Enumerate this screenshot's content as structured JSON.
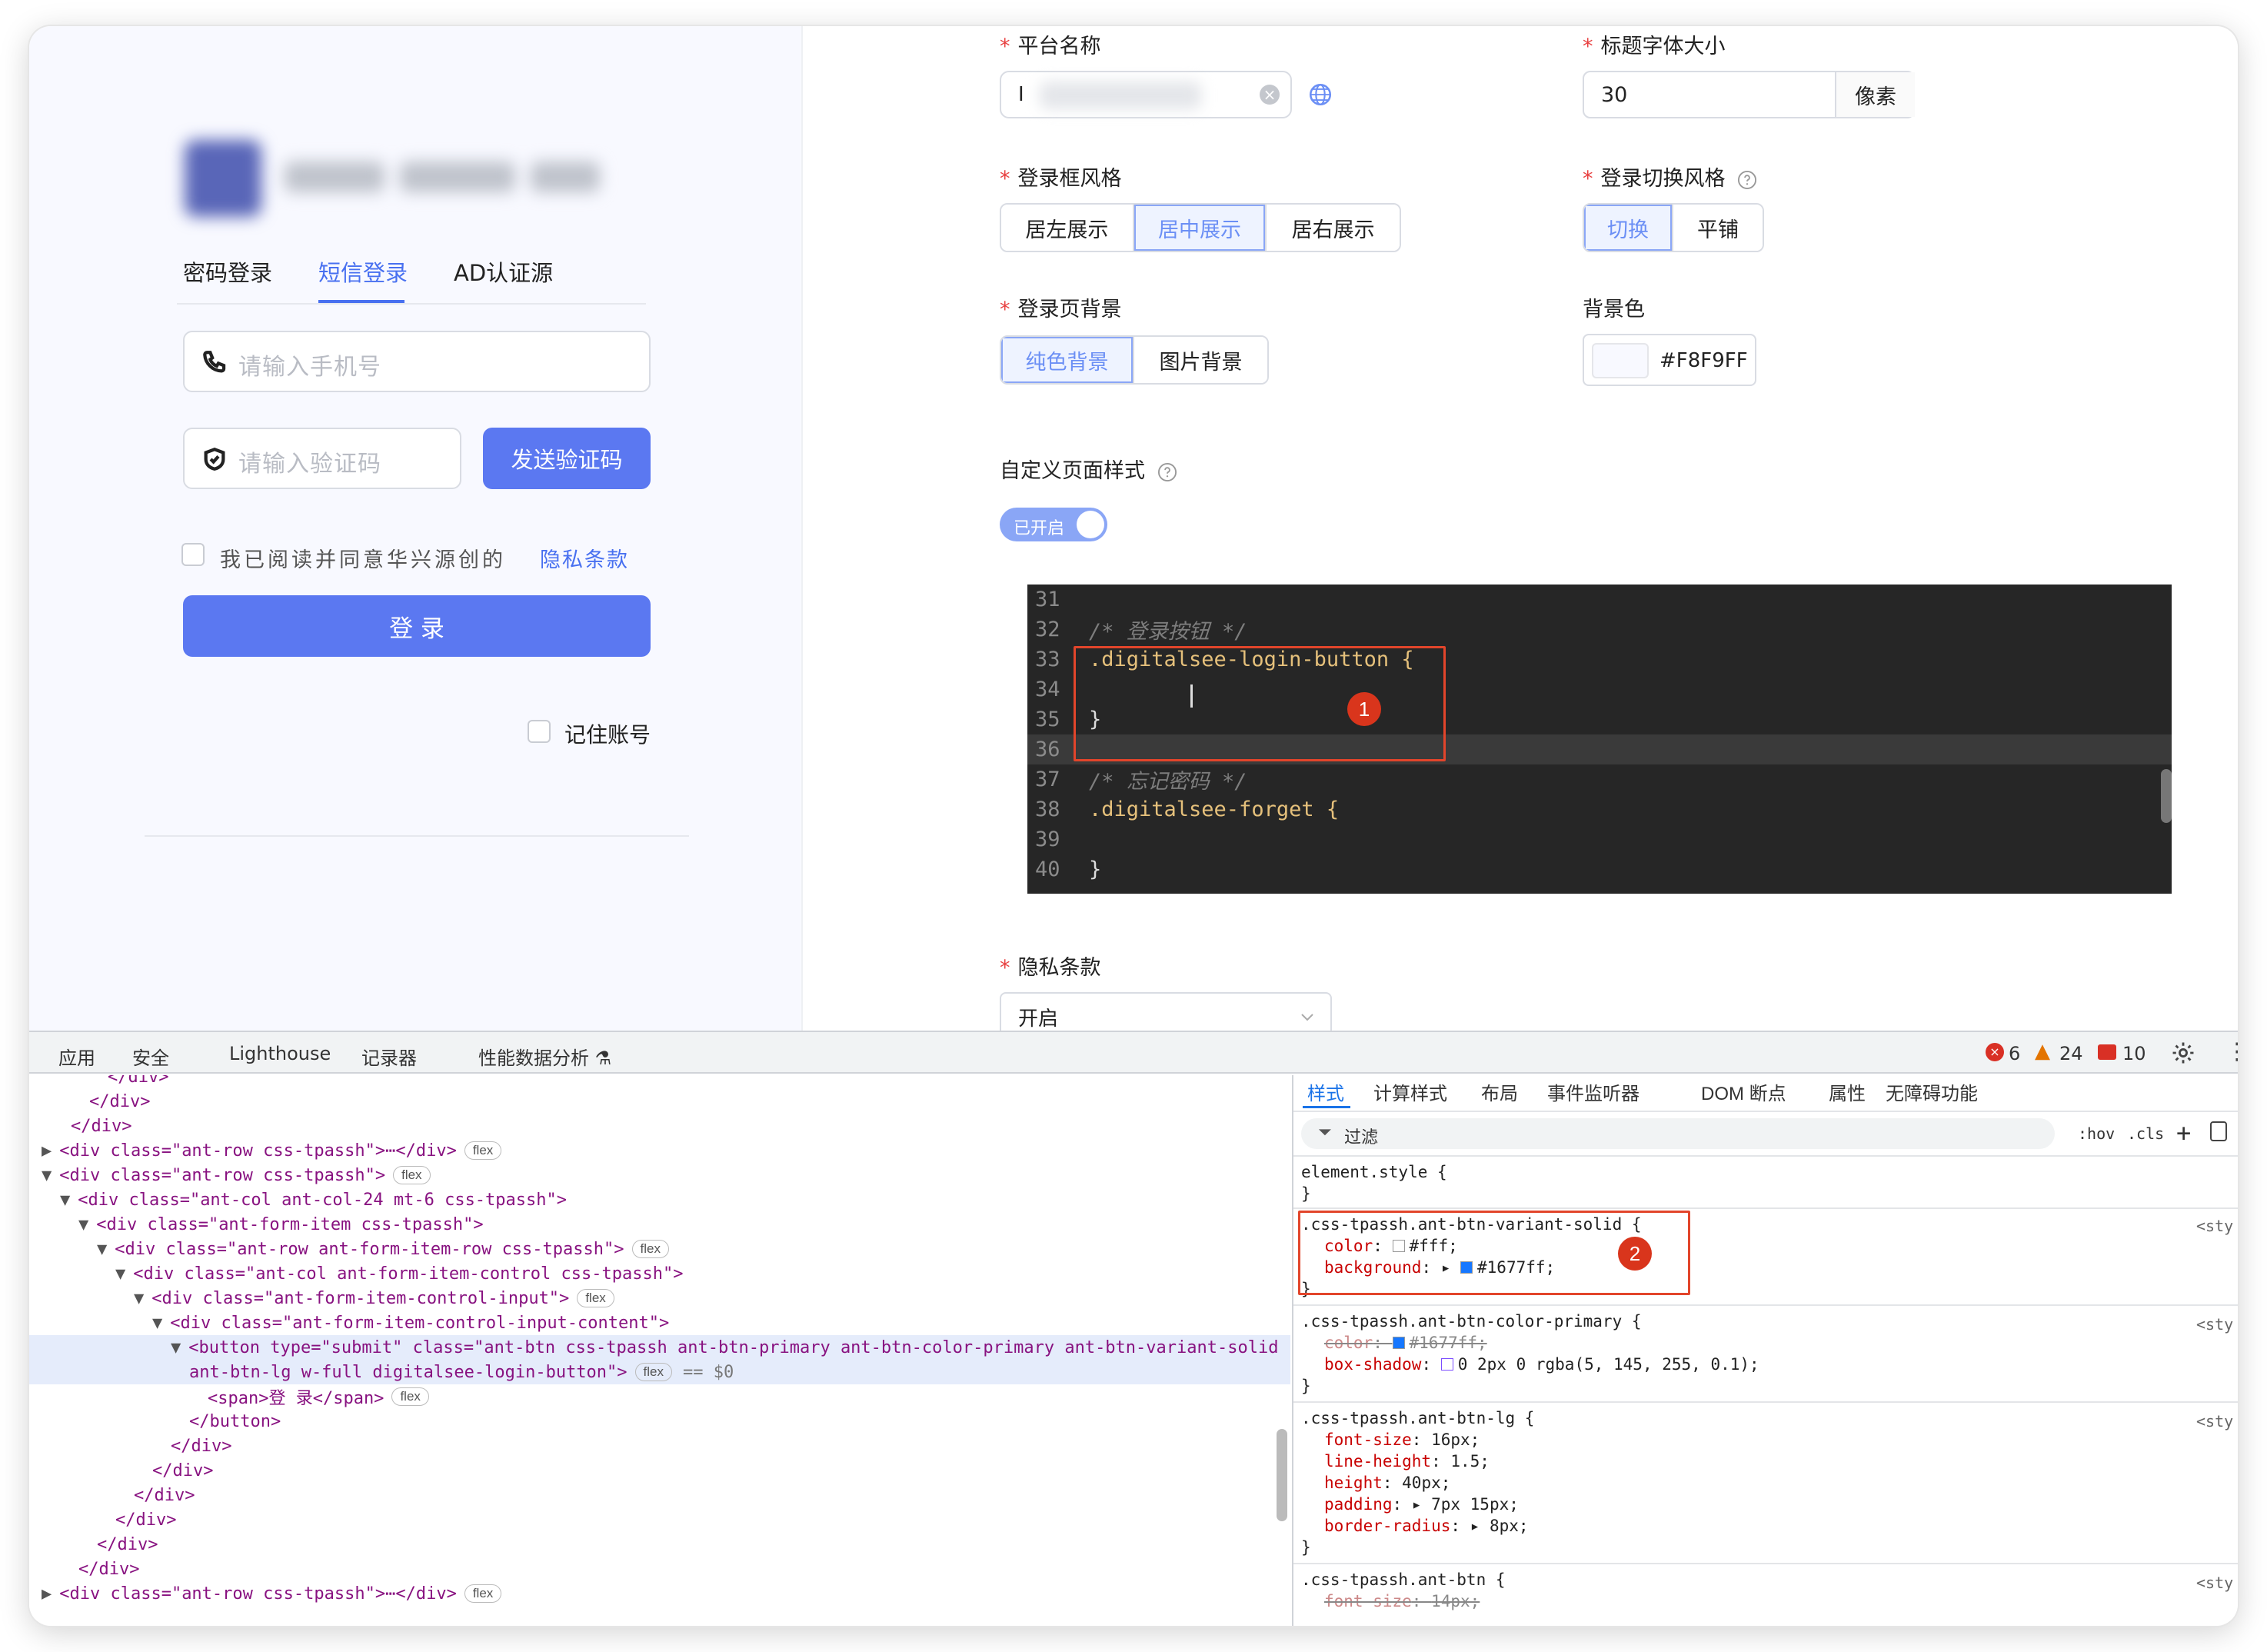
{
  "preview": {
    "tabs": [
      "密码登录",
      "短信登录",
      "AD认证源"
    ],
    "phone_placeholder": "请输入手机号",
    "code_placeholder": "请输入验证码",
    "send_code": "发送验证码",
    "agree_text": "我已阅读并同意华兴源创的",
    "privacy_link": "隐私条款",
    "login": "登 录",
    "remember": "记住账号"
  },
  "settings": {
    "platform_name_label": "平台名称",
    "platform_name_value": "I",
    "title_font_label": "标题字体大小",
    "title_font_value": "30",
    "title_font_unit": "像素",
    "login_box_style_label": "登录框风格",
    "login_box_style_options": [
      "居左展示",
      "居中展示",
      "居右展示"
    ],
    "login_switch_label": "登录切换风格",
    "login_switch_options": [
      "切换",
      "平铺"
    ],
    "bg_label": "登录页背景",
    "bg_options": [
      "纯色背景",
      "图片背景"
    ],
    "bgcolor_label": "背景色",
    "bgcolor_value": "#F8F9FF",
    "custom_style_label": "自定义页面样式",
    "custom_style_toggle": "已开启",
    "privacy_label": "隐私条款",
    "privacy_value": "开启"
  },
  "code_lines": [
    {
      "n": "31",
      "t": ""
    },
    {
      "n": "32",
      "t": "/* 登录按钮 */"
    },
    {
      "n": "33",
      "t": ".digitalsee-login-button {"
    },
    {
      "n": "34",
      "t": ""
    },
    {
      "n": "35",
      "t": "}"
    },
    {
      "n": "36",
      "t": ""
    },
    {
      "n": "37",
      "t": "/* 忘记密码 */"
    },
    {
      "n": "38",
      "t": ".digitalsee-forget {"
    },
    {
      "n": "39",
      "t": ""
    },
    {
      "n": "40",
      "t": "}"
    }
  ],
  "badges": {
    "one": "1",
    "two": "2"
  },
  "devtools": {
    "tabs": [
      "应用",
      "安全",
      "Lighthouse",
      "记录器",
      "性能数据分析 ⚗"
    ],
    "errors": "6",
    "warnings": "24",
    "issues": "10",
    "styles_tabs": [
      "样式",
      "计算样式",
      "布局",
      "事件监听器",
      "DOM 断点",
      "属性",
      "无障碍功能"
    ],
    "filter_placeholder": "过滤",
    "hov": ":hov",
    "cls": ".cls",
    "dom_lines": [
      "</div>",
      "</div>",
      "</div>",
      "<div class=\"ant-row css-tpassh\">⋯</div>",
      "<div class=\"ant-row css-tpassh\">",
      "<div class=\"ant-col ant-col-24 mt-6 css-tpassh\">",
      "<div class=\"ant-form-item css-tpassh\">",
      "<div class=\"ant-row ant-form-item-row css-tpassh\">",
      "<div class=\"ant-col ant-form-item-control css-tpassh\">",
      "<div class=\"ant-form-item-control-input\">",
      "<div class=\"ant-form-item-control-input-content\">",
      "<button type=\"submit\" class=\"ant-btn css-tpassh ant-btn-primary ant-btn-color-primary ant-btn-variant-solid",
      "ant-btn-lg w-full digitalsee-login-button\">",
      "<span>登 录</span>",
      "</button>",
      "</div>",
      "</div>",
      "</div>",
      "</div>",
      "</div>",
      "</div>",
      "<div class=\"ant-row css-tpassh\">⋯</div>"
    ],
    "pill_flex": "flex",
    "eq_dollar": "== $0",
    "styles": [
      "element.style {",
      "}",
      ".css-tpassh.ant-btn-variant-solid {",
      "color",
      "#fff;",
      "background",
      "#1677ff;",
      "}",
      ".css-tpassh.ant-btn-color-primary {",
      "color",
      "#1677ff;",
      "box-shadow",
      "0 2px 0 rgba(5, 145, 255, 0.1);",
      "}",
      ".css-tpassh.ant-btn-lg {",
      "font-size",
      "16px;",
      "line-height",
      "1.5;",
      "height",
      "40px;",
      "padding",
      "7px 15px;",
      "border-radius",
      "8px;",
      "}",
      ".css-tpassh.ant-btn {",
      "font-size",
      "14px;"
    ],
    "source_link": "<sty"
  },
  "colors": {
    "accent": "#5b78f1",
    "blue": "#1677ff",
    "red": "#e2452b"
  }
}
